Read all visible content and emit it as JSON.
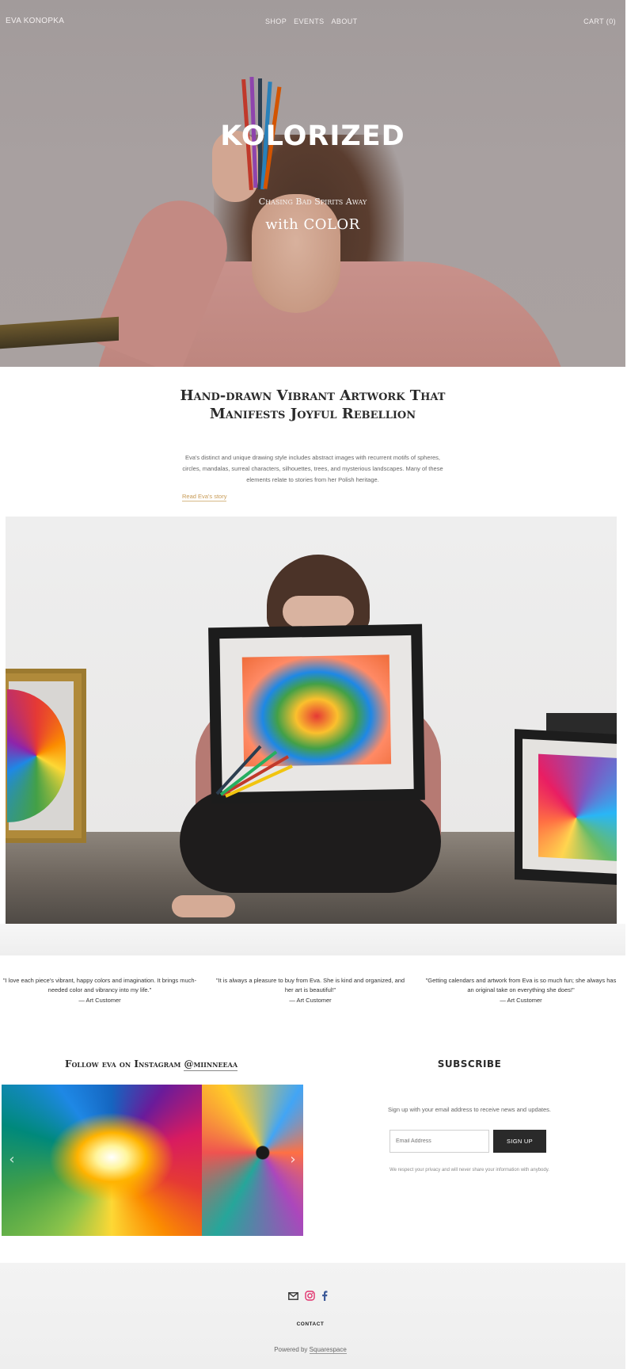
{
  "header": {
    "site_title": "EVA KONOPKA",
    "nav": [
      "SHOP",
      "EVENTS",
      "ABOUT"
    ],
    "cart": "CART (0)"
  },
  "hero": {
    "title": "KOLORIZED",
    "subtitle": "Chasing Bad Spirits Away",
    "subtitle2": "with COLOR"
  },
  "intro": {
    "heading": "Hand-drawn Vibrant Artwork That Manifests Joyful Rebellion",
    "text": "Eva's distinct and unique drawing style includes abstract images with recurrent motifs of spheres, circles, mandalas, surreal characters, silhouettes, trees, and mysterious landscapes. Many of these elements relate to stories from her Polish heritage.",
    "link": "Read Eva's story"
  },
  "testimonials": [
    {
      "quote": "\"I love each piece's vibrant, happy colors and imagination. It brings much-needed color and vibrancy into my life.\"",
      "author": "— Art Customer"
    },
    {
      "quote": "\"It is always a pleasure to buy from Eva. She is kind and organized, and her art is beautiful!\"",
      "author": "— Art Customer"
    },
    {
      "quote": "\"Getting calendars and artwork from Eva is so much fun; she always has an original take on everything she does!\"",
      "author": "— Art Customer"
    }
  ],
  "instagram": {
    "heading": "Follow eva on Instagram ",
    "handle": "@miinneeaa",
    "prev": "‹",
    "next": "›"
  },
  "subscribe": {
    "heading": "SUBSCRIBE",
    "text": "Sign up with your email address to receive news and updates.",
    "placeholder": "Email Address",
    "button": "SIGN UP",
    "privacy": "We respect your privacy and will never share your information with anybody."
  },
  "footer": {
    "contact": "CONTACT",
    "powered_prefix": "Powered by ",
    "powered_link": "Squarespace",
    "icons": [
      "email-icon",
      "instagram-icon",
      "facebook-icon"
    ],
    "colors": {
      "instagram": "#e1306c",
      "facebook": "#3b5998"
    }
  },
  "colors": {
    "accent_link": "#c79a54",
    "button": "#2a2a2a"
  }
}
